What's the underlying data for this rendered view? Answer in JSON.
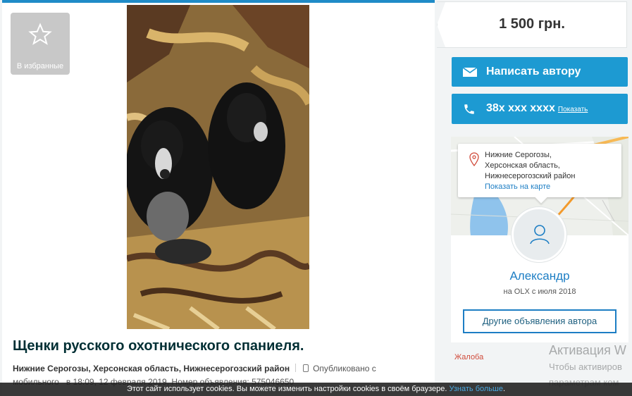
{
  "favorites": {
    "label": "В избранные",
    "icon": "star-icon"
  },
  "listing": {
    "title": "Щенки русского охотнического спаниеля.",
    "location": "Нижние Серогозы, Херсонская область, Нижнесерогозский район",
    "published_prefix": "Опубликовано с",
    "published_line2": "мобильного   в 18:09, 12 февраля 2019, Номер объявления: 575046650"
  },
  "sidebar": {
    "price": "1 500 грн.",
    "message_button": "Написать автору",
    "phone_number": "38x xxx xxxx",
    "phone_show": "Показать",
    "location_lines": [
      "Нижние Серогозы,",
      "Херсонская область,",
      "Нижнесерогозский район"
    ],
    "map_link": "Показать на карте",
    "user_name": "Александр",
    "user_since": "на OLX с июля 2018",
    "other_ads": "Другие объявления автора",
    "complain": "Жалоба"
  },
  "activation": {
    "title": "Активация W",
    "line1": "Чтобы активиров",
    "line2": "параметрам ком"
  },
  "cookie": {
    "text": "Этот сайт использует cookies. Вы можете изменить настройки cookies в своём браузере.",
    "link": "Узнать больше",
    "end": "."
  },
  "colors": {
    "accent": "#1d9ad2",
    "link": "#1d7ec4",
    "complain": "#d04a3a"
  }
}
